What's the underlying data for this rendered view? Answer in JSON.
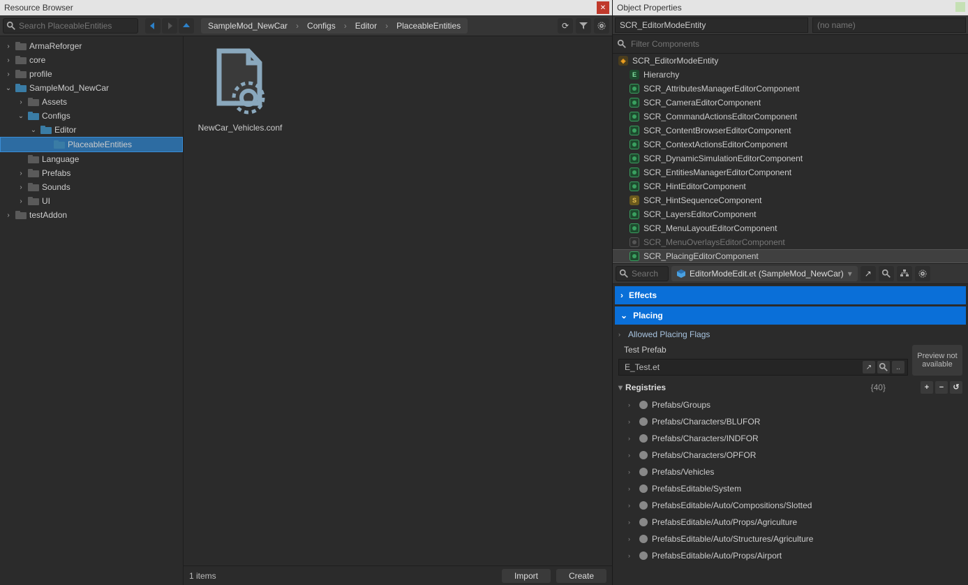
{
  "leftTitle": "Resource Browser",
  "rightTitle": "Object Properties",
  "searchPlaceholder": "Search PlaceableEntities",
  "breadcrumb": [
    "SampleMod_NewCar",
    "Configs",
    "Editor",
    "PlaceableEntities"
  ],
  "tree": [
    {
      "label": "ArmaReforger",
      "depth": 0,
      "expand": "›",
      "folder": "closed"
    },
    {
      "label": "core",
      "depth": 0,
      "expand": "›",
      "folder": "closed"
    },
    {
      "label": "profile",
      "depth": 0,
      "expand": "›",
      "folder": "closed"
    },
    {
      "label": "SampleMod_NewCar",
      "depth": 0,
      "expand": "⌄",
      "folder": "open"
    },
    {
      "label": "Assets",
      "depth": 1,
      "expand": "›",
      "folder": "closed"
    },
    {
      "label": "Configs",
      "depth": 1,
      "expand": "⌄",
      "folder": "open"
    },
    {
      "label": "Editor",
      "depth": 2,
      "expand": "⌄",
      "folder": "open"
    },
    {
      "label": "PlaceableEntities",
      "depth": 3,
      "expand": "",
      "folder": "open",
      "selected": true
    },
    {
      "label": "Language",
      "depth": 1,
      "expand": "",
      "folder": "closed"
    },
    {
      "label": "Prefabs",
      "depth": 1,
      "expand": "›",
      "folder": "closed"
    },
    {
      "label": "Sounds",
      "depth": 1,
      "expand": "›",
      "folder": "closed"
    },
    {
      "label": "UI",
      "depth": 1,
      "expand": "›",
      "folder": "closed"
    },
    {
      "label": "testAddon",
      "depth": 0,
      "expand": "›",
      "folder": "closed"
    }
  ],
  "fileName": "NewCar_Vehicles.conf",
  "statusCount": "1 items",
  "importLabel": "Import",
  "createLabel": "Create",
  "className": "SCR_EditorModeEntity",
  "noName": "(no name)",
  "filterComponents": "Filter Components",
  "components": [
    {
      "label": "SCR_EditorModeEntity",
      "type": "root",
      "child": false
    },
    {
      "label": "Hierarchy",
      "type": "E",
      "child": true
    },
    {
      "label": "SCR_AttributesManagerEditorComponent",
      "type": "O",
      "child": true
    },
    {
      "label": "SCR_CameraEditorComponent",
      "type": "O",
      "child": true
    },
    {
      "label": "SCR_CommandActionsEditorComponent",
      "type": "O",
      "child": true
    },
    {
      "label": "SCR_ContentBrowserEditorComponent",
      "type": "O",
      "child": true
    },
    {
      "label": "SCR_ContextActionsEditorComponent",
      "type": "O",
      "child": true
    },
    {
      "label": "SCR_DynamicSimulationEditorComponent",
      "type": "O",
      "child": true
    },
    {
      "label": "SCR_EntitiesManagerEditorComponent",
      "type": "O",
      "child": true
    },
    {
      "label": "SCR_HintEditorComponent",
      "type": "O",
      "child": true
    },
    {
      "label": "SCR_HintSequenceComponent",
      "type": "S",
      "child": true
    },
    {
      "label": "SCR_LayersEditorComponent",
      "type": "O",
      "child": true
    },
    {
      "label": "SCR_MenuLayoutEditorComponent",
      "type": "O",
      "child": true
    },
    {
      "label": "SCR_MenuOverlaysEditorComponent",
      "type": "Odim",
      "child": true,
      "dim": true
    },
    {
      "label": "SCR_PlacingEditorComponent",
      "type": "O",
      "child": true,
      "selected": true
    }
  ],
  "propSearch": "Search",
  "etPath": "EditorModeEdit.et (SampleMod_NewCar)",
  "sectionEffects": "Effects",
  "sectionPlacing": "Placing",
  "allowedFlags": "Allowed Placing Flags",
  "testPrefabLabel": "Test Prefab",
  "testPrefabValue": "E_Test.et",
  "previewText": "Preview not available",
  "registriesLabel": "Registries",
  "registriesCount": "{40}",
  "registries": [
    "Prefabs/Groups",
    "Prefabs/Characters/BLUFOR",
    "Prefabs/Characters/INDFOR",
    "Prefabs/Characters/OPFOR",
    "Prefabs/Vehicles",
    "PrefabsEditable/System",
    "PrefabsEditable/Auto/Compositions/Slotted",
    "PrefabsEditable/Auto/Props/Agriculture",
    "PrefabsEditable/Auto/Structures/Agriculture",
    "PrefabsEditable/Auto/Props/Airport"
  ]
}
